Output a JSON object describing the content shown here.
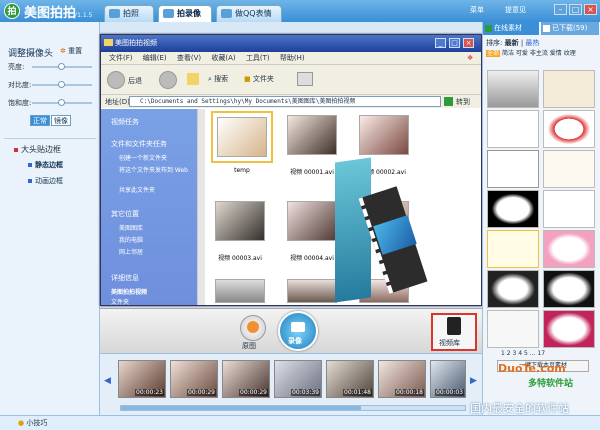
{
  "app": {
    "name": "美图拍拍",
    "version": "V1.1.5"
  },
  "tabs": [
    {
      "label": "拍照"
    },
    {
      "label": "拍录像"
    },
    {
      "label": "做QQ表情"
    }
  ],
  "topbar": {
    "menu": "菜单",
    "feedback": "提意见"
  },
  "left": {
    "camera_title": "调整摄像头",
    "reset": "重置",
    "sliders": [
      "亮度:",
      "对比度:",
      "饱和度:"
    ],
    "mode_normal": "正常",
    "mode_mirror": "镜像",
    "frame_group": "大头贴边框",
    "frame_static": "静态边框",
    "frame_animated": "动画边框"
  },
  "explorer": {
    "title": "美图拍拍视频",
    "menu": [
      "文件(F)",
      "编辑(E)",
      "查看(V)",
      "收藏(A)",
      "工具(T)",
      "帮助(H)"
    ],
    "back": "后退",
    "search": "搜索",
    "folders": "文件夹",
    "address_label": "地址(D)",
    "address": "C:\\Documents and Settings\\hy\\My Documents\\美图图库\\美图拍拍视频",
    "go": "转到",
    "side": {
      "video_tasks": "视频任务",
      "file_tasks": "文件和文件夹任务",
      "tasks": [
        "创建一个新文件夹",
        "将这个文件夹发布到 Web",
        "共享此文件夹"
      ],
      "other": "其它位置",
      "places": [
        "美图图库",
        "我的电脑",
        "网上邻居"
      ],
      "details": "详细信息",
      "folder_name": "美图拍拍视频",
      "folder_type": "文件夹"
    },
    "files": [
      "temp",
      "视频  00001.avi",
      "视频  00002.avi",
      "视频  00003.avi",
      "视频  00004.avi",
      "",
      "",
      "",
      ""
    ]
  },
  "bottom": {
    "original": "原图",
    "record": "录像",
    "library": "视频库"
  },
  "strip": {
    "times": [
      "00:00:23",
      "00:00:29",
      "00:00:29",
      "00:03:39",
      "00:01:48",
      "00:00:18",
      "00:00:03"
    ]
  },
  "right": {
    "online_tab": "在线素材",
    "downloaded_tab": "已下载(59)",
    "sort_label": "排序:",
    "sort_newest": "最新",
    "sort_hot": "最热",
    "filter_label": "全部",
    "filters": [
      "简洁",
      "可爱",
      "非主流",
      "爱情",
      "纹理"
    ],
    "pages": [
      "1",
      "2",
      "3",
      "4",
      "5",
      "...",
      "17"
    ],
    "download_more": "一键下载本页素材"
  },
  "status": {
    "tips": "小技巧"
  },
  "watermark": {
    "site": "DuoTe.com",
    "cn": "多特软件站",
    "slogan": "国内最安全的软件站"
  },
  "colors": {
    "titlebar": "#3a8fd6",
    "accent_green": "#2e9b3a",
    "explorer_title": "#1e3f99",
    "library_highlight": "#d9362c"
  }
}
